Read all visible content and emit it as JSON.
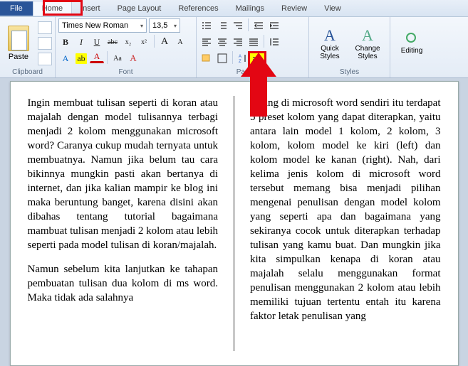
{
  "menu": {
    "file": "File",
    "home": "Home",
    "insert": "Insert",
    "pagelayout": "Page Layout",
    "references": "References",
    "mailings": "Mailings",
    "review": "Review",
    "view": "View"
  },
  "ribbon": {
    "clipboard": {
      "label": "Clipboard",
      "paste": "Paste"
    },
    "font": {
      "label": "Font",
      "name": "Times New Roman",
      "size": "13,5",
      "bold": "B",
      "italic": "I",
      "underline": "U",
      "strike": "abc",
      "sub": "x₂",
      "sup": "x²",
      "grow": "A",
      "shrink": "A",
      "case": "Aa",
      "clear": "A",
      "textfx": "A",
      "highlight": "ab",
      "color": "A"
    },
    "paragraph": {
      "label": "Paragra…"
    },
    "styles": {
      "label": "Styles",
      "quick": "Quick Styles",
      "change": "Change Styles"
    },
    "editing": {
      "label": "Editing"
    }
  },
  "doc": {
    "col1": {
      "p1": "Ingin membuat tulisan seperti di koran atau majalah dengan model tulisannya terbagi menjadi 2 kolom menggunakan microsoft word? Caranya cukup mudah ternyata untuk membuatnya. Namun jika belum tau cara bikinnya mungkin pasti akan bertanya di internet, dan jika kalian mampir ke blog ini maka beruntung banget, karena disini akan dibahas tentang tutorial bagaimana mambuat tulisan menjadi 2 kolom atau lebih seperti pada model tulisan di koran/majalah.",
      "p2": "Namun sebelum kita lanjutkan ke tahapan pembuatan tulisan dua kolom di ms word. Maka tidak ada salahnya"
    },
    "col2": {
      "p1": "emang di microsoft word sendiri itu terdapat 5 preset kolom yang dapat diterapkan, yaitu antara lain model 1 kolom, 2 kolom, 3 kolom, kolom model ke kiri (left) dan kolom model ke kanan (right). Nah, dari kelima jenis kolom di microsoft word tersebut memang bisa menjadi pilihan mengenai penulisan dengan model kolom yang seperti apa dan bagaimana yang sekiranya cocok untuk diterapkan terhadap tulisan yang kamu buat. Dan mungkin jika kita simpulkan kenapa di koran atau majalah selalu menggunakan format penulisan menggunakan 2 kolom atau lebih memiliki tujuan tertentu entah itu karena faktor letak penulisan yang"
    }
  }
}
